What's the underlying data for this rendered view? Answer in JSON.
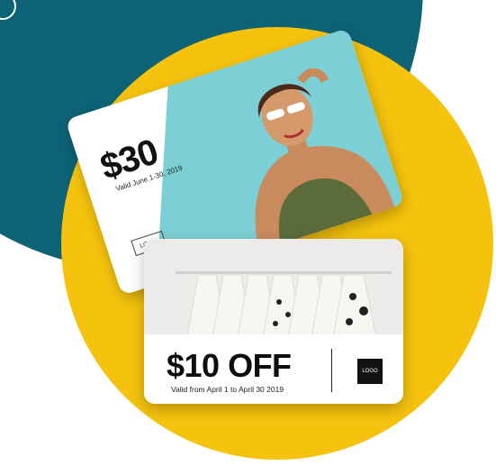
{
  "card_back": {
    "amount": "$30",
    "valid_text": "Valid June 1-30, 2019",
    "logo_text": "LOGO"
  },
  "card_front": {
    "amount": "$10 OFF",
    "valid_text": "Valid from April 1 to April 30 2019",
    "logo_text": "LOGO"
  },
  "colors": {
    "teal": "#0d6275",
    "yellow": "#f5c30e",
    "card_sky": "#7ccfd4"
  },
  "icons": {
    "corner_ring": "circle-outline-icon"
  }
}
